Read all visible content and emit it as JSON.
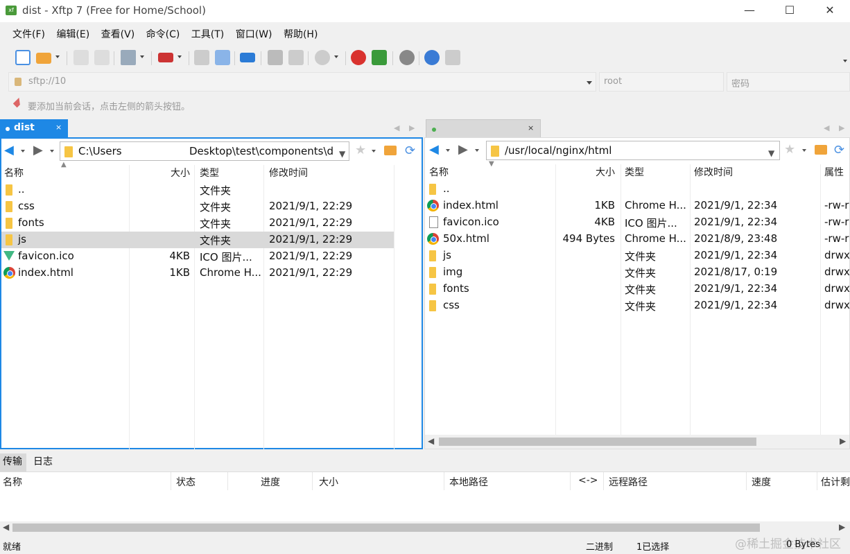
{
  "window": {
    "title": "dist - Xftp 7 (Free for Home/School)",
    "app_icon_text": "xf",
    "minimize": "—",
    "maximize": "☐",
    "close": "✕"
  },
  "menu": [
    "文件(F)",
    "编辑(E)",
    "查看(V)",
    "命令(C)",
    "工具(T)",
    "窗口(W)",
    "帮助(H)"
  ],
  "address": {
    "host_text": "sftp://10",
    "username_placeholder": "root",
    "password_placeholder": "密码"
  },
  "hint": "要添加当前会话，点击左侧的箭头按钮。",
  "left_panel": {
    "tab_label": "dist",
    "tab_close": "×",
    "path": "C:\\Users",
    "path_suffix": "Desktop\\test\\components\\d",
    "columns": [
      "名称",
      "大小",
      "类型",
      "修改时间"
    ],
    "rows": [
      {
        "icon": "folder-icon",
        "name": "..",
        "size": "",
        "type": "文件夹",
        "modified": ""
      },
      {
        "icon": "folder-icon",
        "name": "css",
        "size": "",
        "type": "文件夹",
        "modified": "2021/9/1, 22:29"
      },
      {
        "icon": "folder-icon",
        "name": "fonts",
        "size": "",
        "type": "文件夹",
        "modified": "2021/9/1, 22:29"
      },
      {
        "icon": "folder-icon",
        "name": "js",
        "size": "",
        "type": "文件夹",
        "modified": "2021/9/1, 22:29",
        "selected": true
      },
      {
        "icon": "vue-icon",
        "name": "favicon.ico",
        "size": "4KB",
        "type": "ICO 图片...",
        "modified": "2021/9/1, 22:29"
      },
      {
        "icon": "chrome-icon",
        "name": "index.html",
        "size": "1KB",
        "type": "Chrome H...",
        "modified": "2021/9/1, 22:29"
      }
    ]
  },
  "right_panel": {
    "tab_close": "×",
    "path": "/usr/local/nginx/html",
    "columns": [
      "名称",
      "大小",
      "类型",
      "修改时间",
      "属性"
    ],
    "rows": [
      {
        "icon": "folder-icon",
        "name": "..",
        "size": "",
        "type": "",
        "modified": "",
        "attr": ""
      },
      {
        "icon": "chrome-icon",
        "name": "index.html",
        "size": "1KB",
        "type": "Chrome H...",
        "modified": "2021/9/1, 22:34",
        "attr": "-rw-r"
      },
      {
        "icon": "file-icon",
        "name": "favicon.ico",
        "size": "4KB",
        "type": "ICO 图片...",
        "modified": "2021/9/1, 22:34",
        "attr": "-rw-r"
      },
      {
        "icon": "chrome-icon",
        "name": "50x.html",
        "size": "494 Bytes",
        "type": "Chrome H...",
        "modified": "2021/8/9, 23:48",
        "attr": "-rw-r"
      },
      {
        "icon": "folder-icon",
        "name": "js",
        "size": "",
        "type": "文件夹",
        "modified": "2021/9/1, 22:34",
        "attr": "drwx"
      },
      {
        "icon": "folder-icon",
        "name": "img",
        "size": "",
        "type": "文件夹",
        "modified": "2021/8/17, 0:19",
        "attr": "drwx"
      },
      {
        "icon": "folder-icon",
        "name": "fonts",
        "size": "",
        "type": "文件夹",
        "modified": "2021/9/1, 22:34",
        "attr": "drwx"
      },
      {
        "icon": "folder-icon",
        "name": "css",
        "size": "",
        "type": "文件夹",
        "modified": "2021/9/1, 22:34",
        "attr": "drwx"
      }
    ]
  },
  "bottom": {
    "tabs": [
      "传输",
      "日志"
    ],
    "columns": [
      "名称",
      "状态",
      "进度",
      "大小",
      "本地路径",
      "<->",
      "远程路径",
      "速度",
      "估计剩"
    ]
  },
  "status": {
    "text": "就绪",
    "mode": "二进制",
    "selected": "1已选择",
    "size": "0 Bytes",
    "watermark": "@稀土掘金技术社区"
  },
  "colors": {
    "accent": "#1e88e5",
    "selected_row": "#d9d9d9",
    "folder": "#f6c544"
  }
}
